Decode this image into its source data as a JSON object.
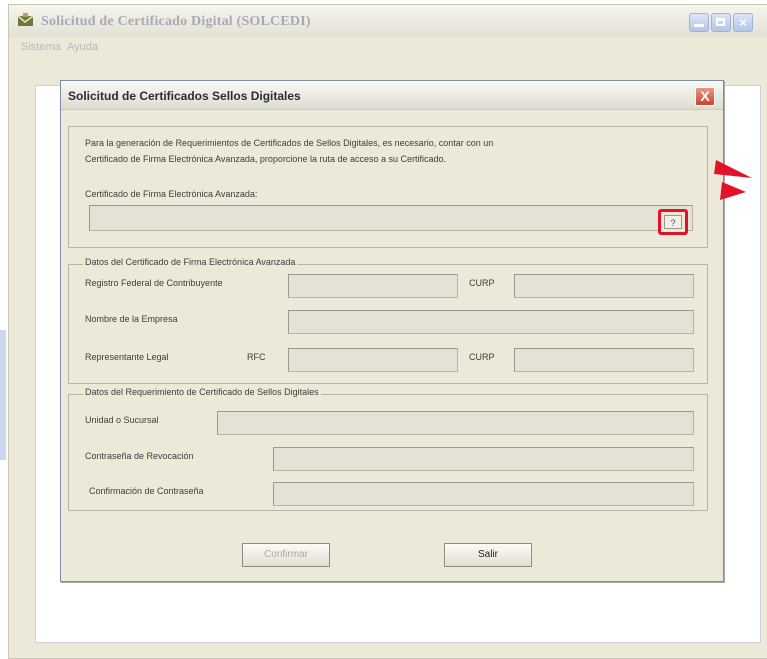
{
  "app": {
    "title": "Solicitud de Certificado Digital (SOLCEDI)",
    "menu": [
      "Sistema",
      "Ayuda"
    ]
  },
  "dialog": {
    "title": "Solicitud de Certificados Sellos Digitales",
    "close_label": "X",
    "intro_line1": "Para la generación de Requerimientos de Certificados de Sellos Digitales, es necesario, contar con un",
    "intro_line2": "Certificado de Firma Electrónica Avanzada, proporcione la ruta de acceso a su Certificado.",
    "cert_label": "Certificado de Firma Electrónica Avanzada:",
    "browse_label": "?",
    "group2": {
      "legend": "Datos del Certificado de Firma Electrónica Avanzada",
      "rfc_label": "Registro Federal de Contribuyente",
      "curp_label": "CURP",
      "empresa_label": "Nombre de la Empresa",
      "rep_label": "Representante Legal",
      "rep_rfc_label": "RFC",
      "rep_curp_label": "CURP"
    },
    "group3": {
      "legend": "Datos del Requerimiento de Certificado de Sellos Digitales",
      "unidad_label": "Unidad o Sucursal",
      "contrasena_label": "Contraseña de Revocación",
      "confirmacion_label": "Confirmación de Contraseña"
    },
    "buttons": {
      "confirm": "Confirmar",
      "exit": "Salir"
    }
  },
  "colors": {
    "highlight": "#e4112a"
  }
}
